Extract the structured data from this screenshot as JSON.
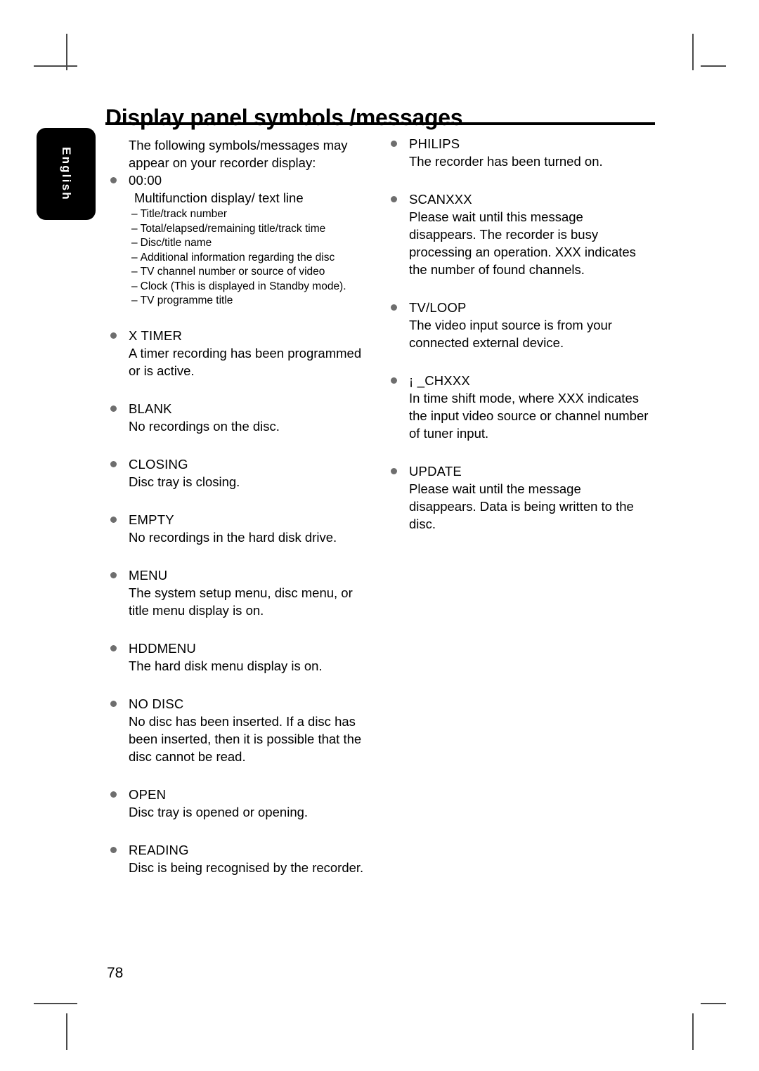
{
  "page": {
    "title": "Display panel symbols /messages",
    "language_tab": "English",
    "page_number": "78"
  },
  "left_column": {
    "intro": "The following symbols/messages may appear on your recorder display:",
    "entries": [
      {
        "term": "00:00",
        "sublead": "Multifunction display/ text line",
        "subitems": [
          "Title/track number",
          "Total/elapsed/remaining title/track time",
          "Disc/title name",
          "Additional information regarding the disc",
          "TV channel number or source of video",
          "Clock (This is displayed in Standby mode).",
          "TV programme title"
        ]
      },
      {
        "term": "X  TIMER",
        "desc": "A timer recording has been programmed or is active."
      },
      {
        "term": "BLANK",
        "desc": "No recordings on the disc."
      },
      {
        "term": "CLOSING",
        "desc": "Disc tray is closing."
      },
      {
        "term": "EMPTY",
        "desc": "No recordings in the hard disk drive."
      },
      {
        "term": "MENU",
        "desc": "The system setup menu, disc menu, or title menu display is on."
      },
      {
        "term": "HDDMENU",
        "desc": "The hard disk menu display is on."
      },
      {
        "term": "NO DISC",
        "desc": "No disc has been inserted. If a disc has been inserted, then it is possible that the disc cannot be read."
      },
      {
        "term": "OPEN",
        "desc": "Disc tray is opened or opening."
      },
      {
        "term": "READING",
        "desc": "Disc is being recognised by the recorder."
      }
    ]
  },
  "right_column": {
    "entries": [
      {
        "term": "PHILIPS",
        "desc": "The recorder has been turned on."
      },
      {
        "term": "SCANXXX",
        "desc": "Please wait until this message disappears. The recorder is busy processing an operation. XXX indicates the number of found channels."
      },
      {
        "term": "TV/LOOP",
        "desc": "The video input source is from your connected external device."
      },
      {
        "term": "¡  _CHXXX",
        "desc": "In time shift mode, where XXX indicates the input video source or channel number of tuner input."
      },
      {
        "term": "UPDATE",
        "desc": "Please wait until the message disappears. Data is being written to the disc."
      }
    ]
  },
  "icons": {
    "bullet": "bullet-dot",
    "subitem_dash": "–"
  },
  "colors": {
    "text": "#000000",
    "bullet": "#6e6e6e",
    "tab_background": "#000000",
    "tab_text": "#ffffff",
    "crop_mark": "#4a4a4a"
  }
}
